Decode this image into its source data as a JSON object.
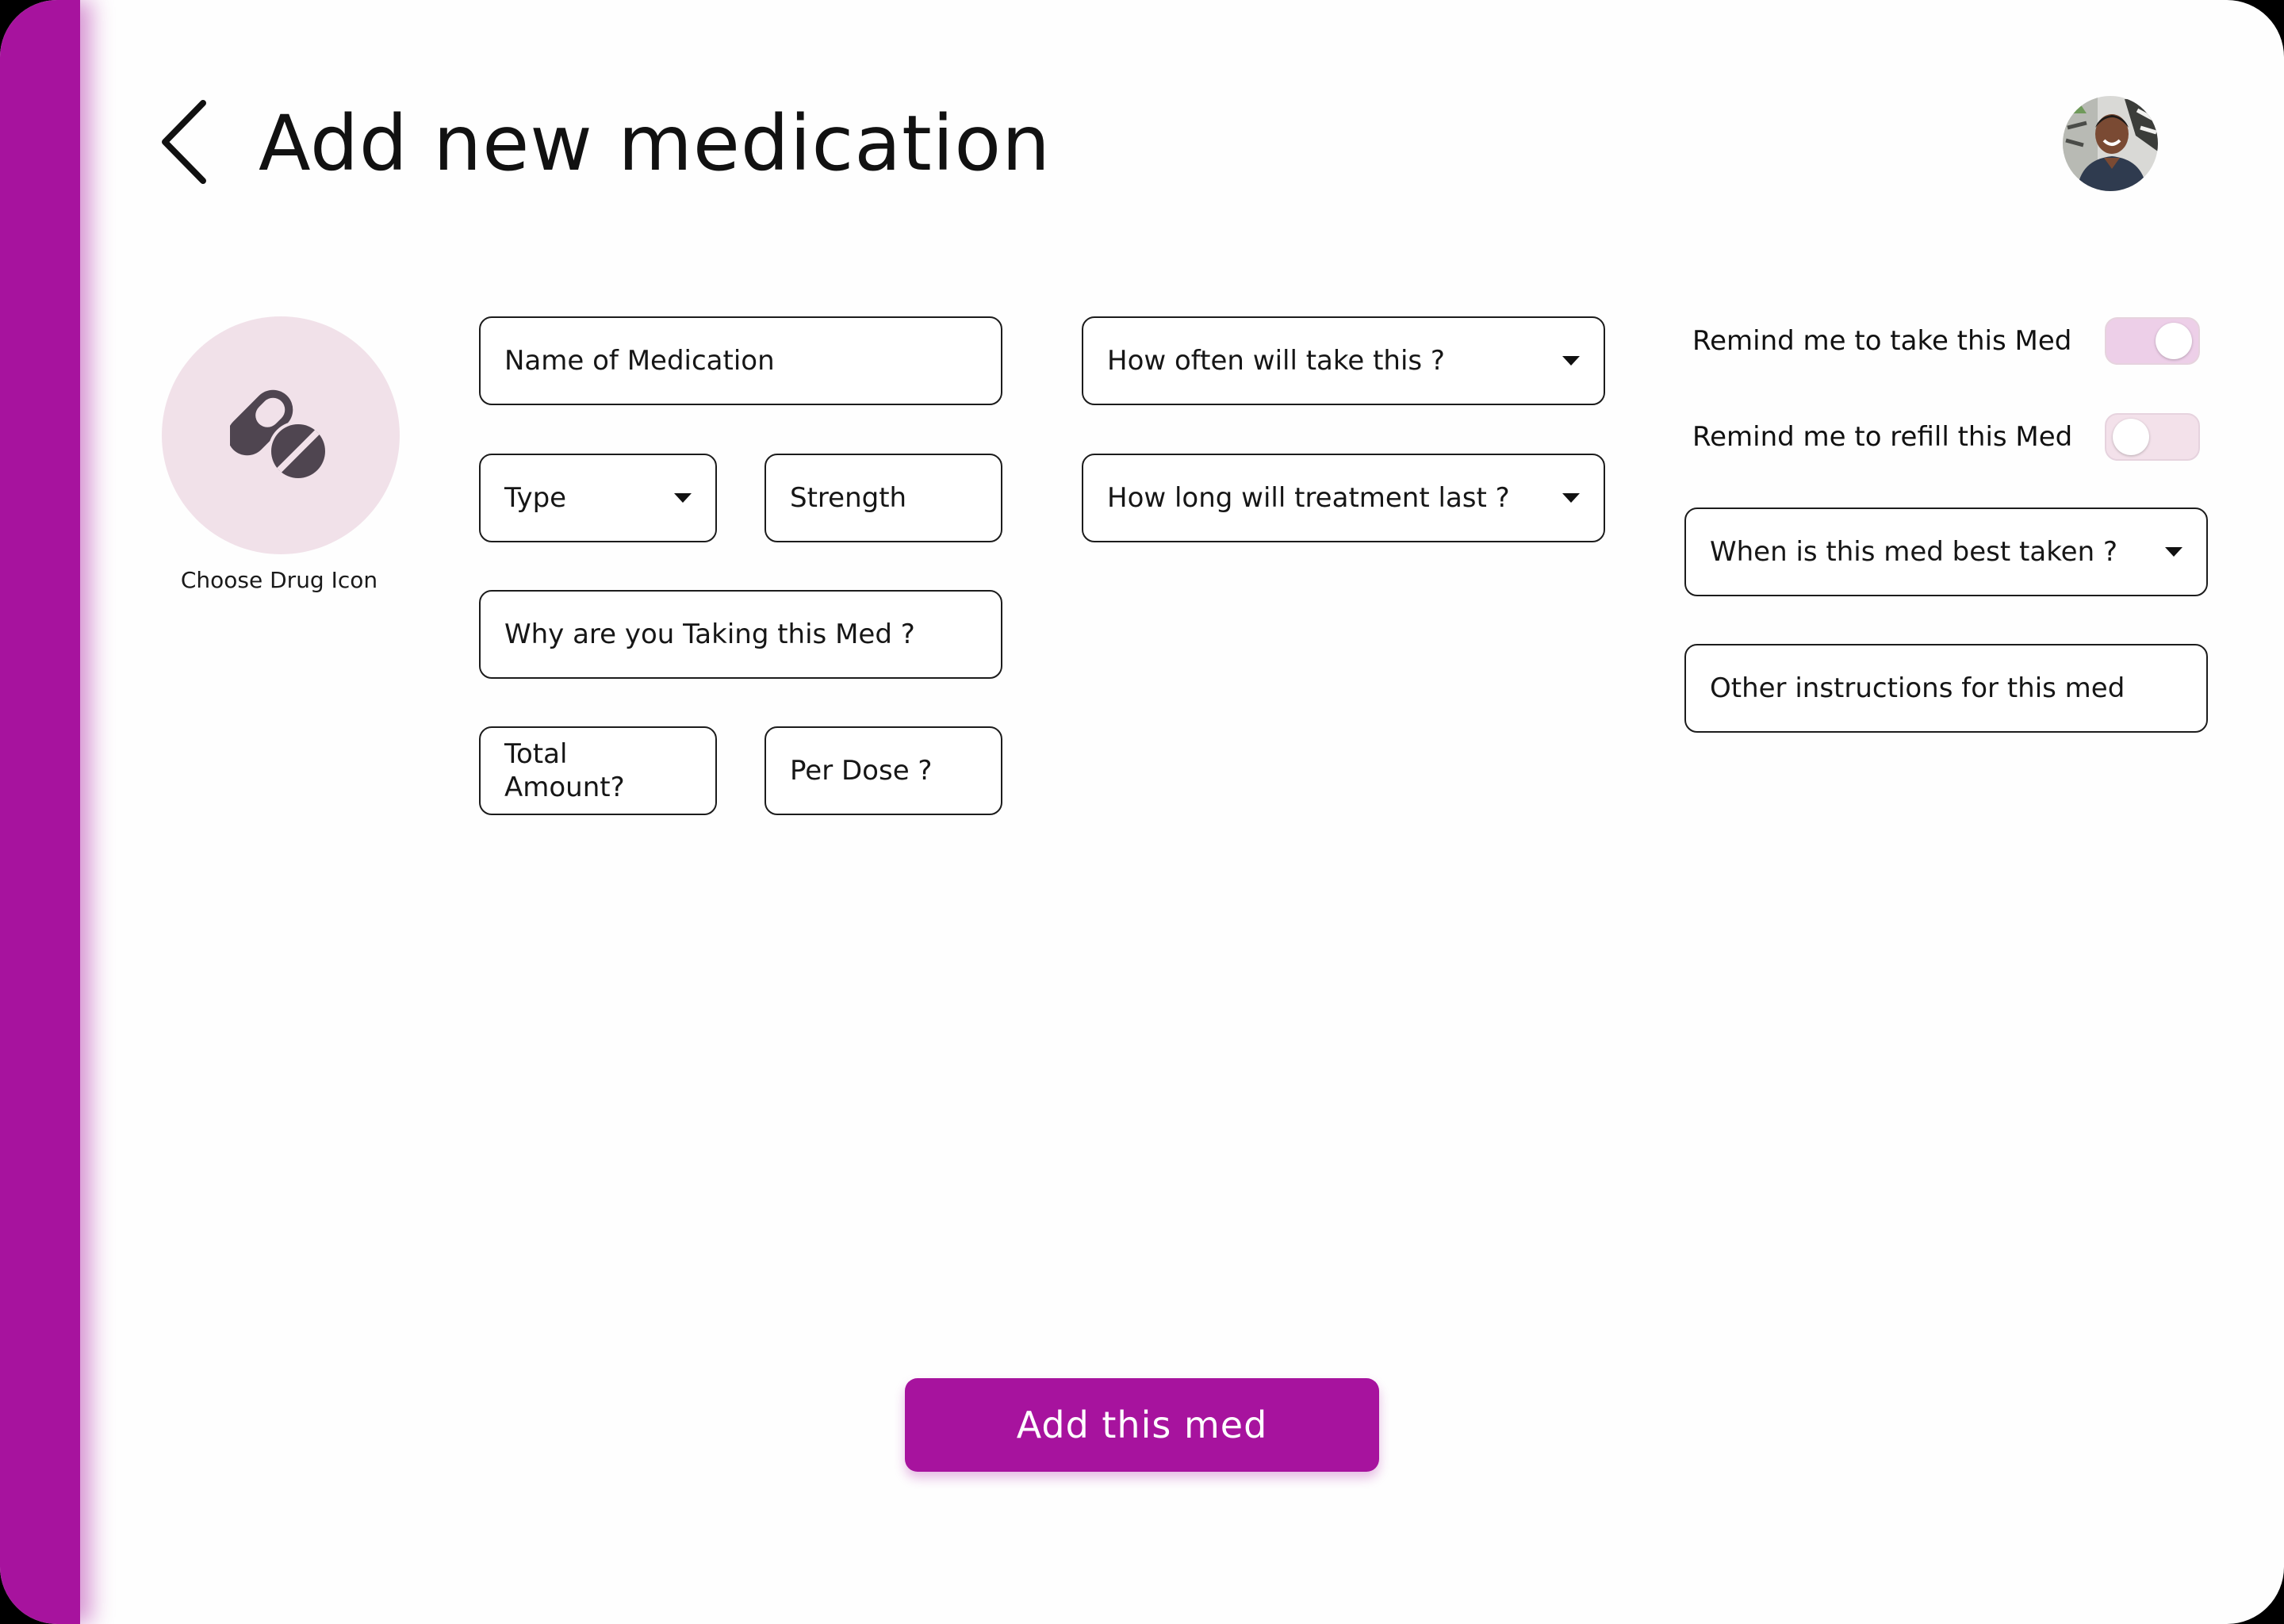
{
  "header": {
    "title": "Add new medication",
    "back_icon": "chevron-left-icon",
    "avatar_icon": "user-avatar"
  },
  "drug_icon": {
    "label": "Choose Drug Icon",
    "icon": "pills-icon"
  },
  "form": {
    "name_placeholder": "Name of Medication",
    "type_placeholder": "Type",
    "strength_placeholder": "Strength",
    "reason_placeholder": "Why are you Taking this Med ?",
    "total_amount_placeholder": "Total Amount?",
    "per_dose_placeholder": "Per Dose ?",
    "frequency_placeholder": "How often will take this ?",
    "duration_placeholder": "How long will treatment last ?",
    "best_time_placeholder": "When is this med best taken ?",
    "instructions_placeholder": "Other instructions for this med"
  },
  "toggles": [
    {
      "label": "Remind me to take this Med",
      "state": "on"
    },
    {
      "label": "Remind me to refill this Med",
      "state": "off"
    }
  ],
  "actions": {
    "submit_label": "Add this med"
  },
  "colors": {
    "accent": "#a7139e",
    "icon_circle": "#f1e1e9",
    "toggle_on": "#edcfe8",
    "toggle_off": "#f3e1ea"
  }
}
